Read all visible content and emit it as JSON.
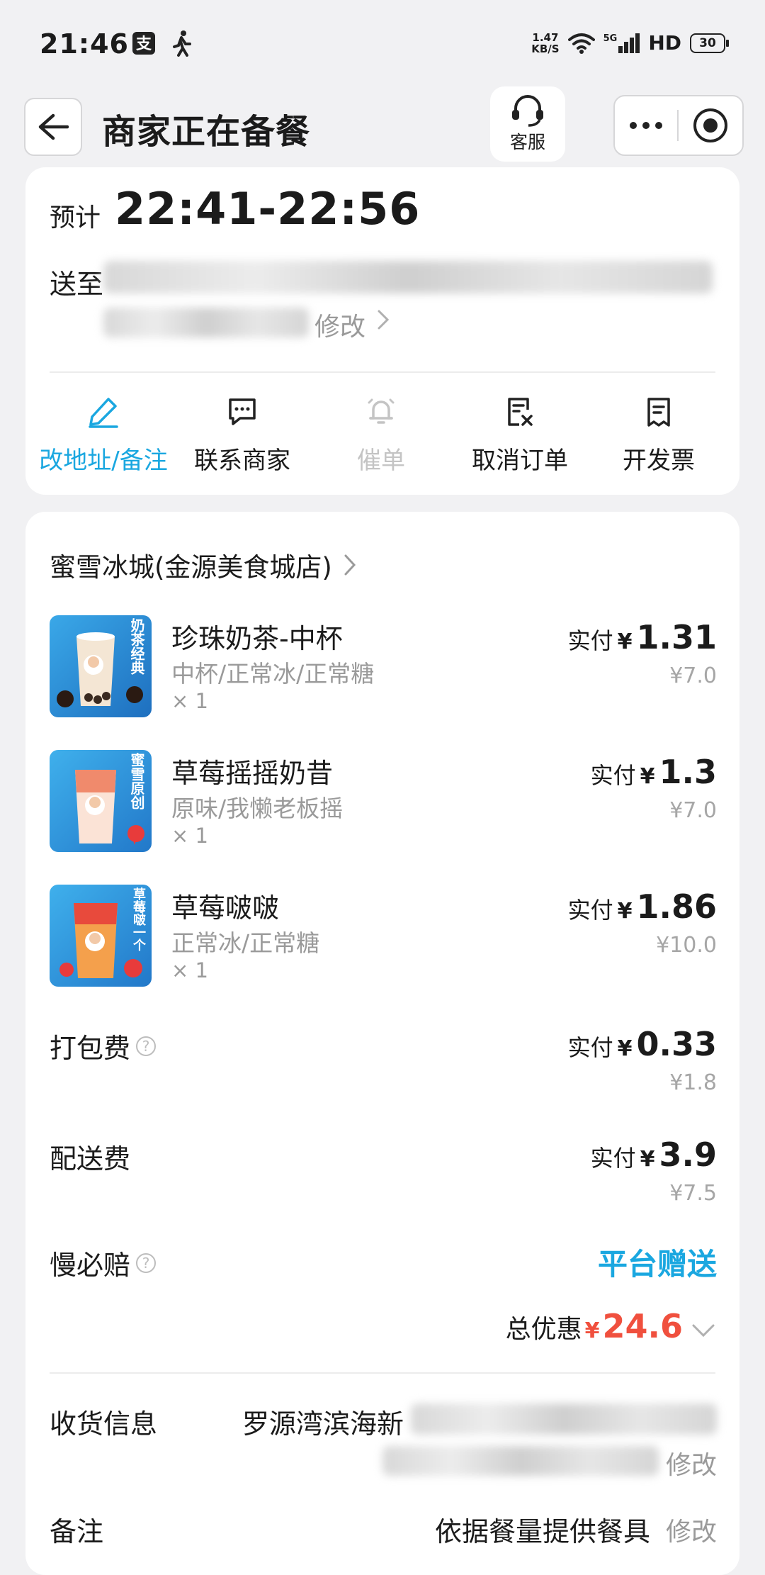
{
  "status_bar": {
    "time": "21:46",
    "net_speed_value": "1.47",
    "net_speed_unit": "KB/S",
    "signal_label": "5G",
    "hd_label": "HD",
    "battery": "30"
  },
  "nav": {
    "title": "商家正在备餐",
    "customer_service_label": "客服"
  },
  "delivery": {
    "eta_prefix": "预计",
    "eta_time": "22:41-22:56",
    "address_prefix": "送至",
    "modify_label": "修改"
  },
  "actions": [
    {
      "label": "改地址/备注",
      "icon": "edit-icon",
      "state": "active"
    },
    {
      "label": "联系商家",
      "icon": "chat-icon",
      "state": "normal"
    },
    {
      "label": "催单",
      "icon": "bell-icon",
      "state": "disabled"
    },
    {
      "label": "取消订单",
      "icon": "cancel-doc-icon",
      "state": "normal"
    },
    {
      "label": "开发票",
      "icon": "receipt-icon",
      "state": "normal"
    }
  ],
  "shop": {
    "name": "蜜雪冰城(金源美食城店)"
  },
  "items": [
    {
      "name": "珍珠奶茶-中杯",
      "spec": "中杯/正常冰/正常糖",
      "qty": "× 1",
      "paid_label": "实付",
      "yen": "¥",
      "paid": "1.31",
      "original": "¥7.0",
      "thumb_text": "奶茶经典"
    },
    {
      "name": "草莓摇摇奶昔",
      "spec": "原味/我懒老板摇",
      "qty": "× 1",
      "paid_label": "实付",
      "yen": "¥",
      "paid": "1.3",
      "original": "¥7.0",
      "thumb_text": "蜜雪原创"
    },
    {
      "name": "草莓啵啵",
      "spec": "正常冰/正常糖",
      "qty": "× 1",
      "paid_label": "实付",
      "yen": "¥",
      "paid": "1.86",
      "original": "¥10.0",
      "thumb_text": "草莓啵一个"
    }
  ],
  "fees": {
    "packing": {
      "label": "打包费",
      "paid_label": "实付",
      "yen": "¥",
      "paid": "0.33",
      "original": "¥1.8"
    },
    "delivery": {
      "label": "配送费",
      "paid_label": "实付",
      "yen": "¥",
      "paid": "3.9",
      "original": "¥7.5"
    },
    "late_comp": {
      "label": "慢必赔",
      "value": "平台赠送"
    }
  },
  "discount": {
    "label": "总优惠",
    "yen": "¥",
    "value": "24.6"
  },
  "receiver": {
    "label": "收货信息",
    "value": "罗源湾滨海新",
    "modify": "修改"
  },
  "note": {
    "label": "备注",
    "value": "依据餐量提供餐具",
    "modify": "修改"
  },
  "colors": {
    "accent_blue": "#1aa7e0",
    "discount_red": "#f0503e"
  }
}
